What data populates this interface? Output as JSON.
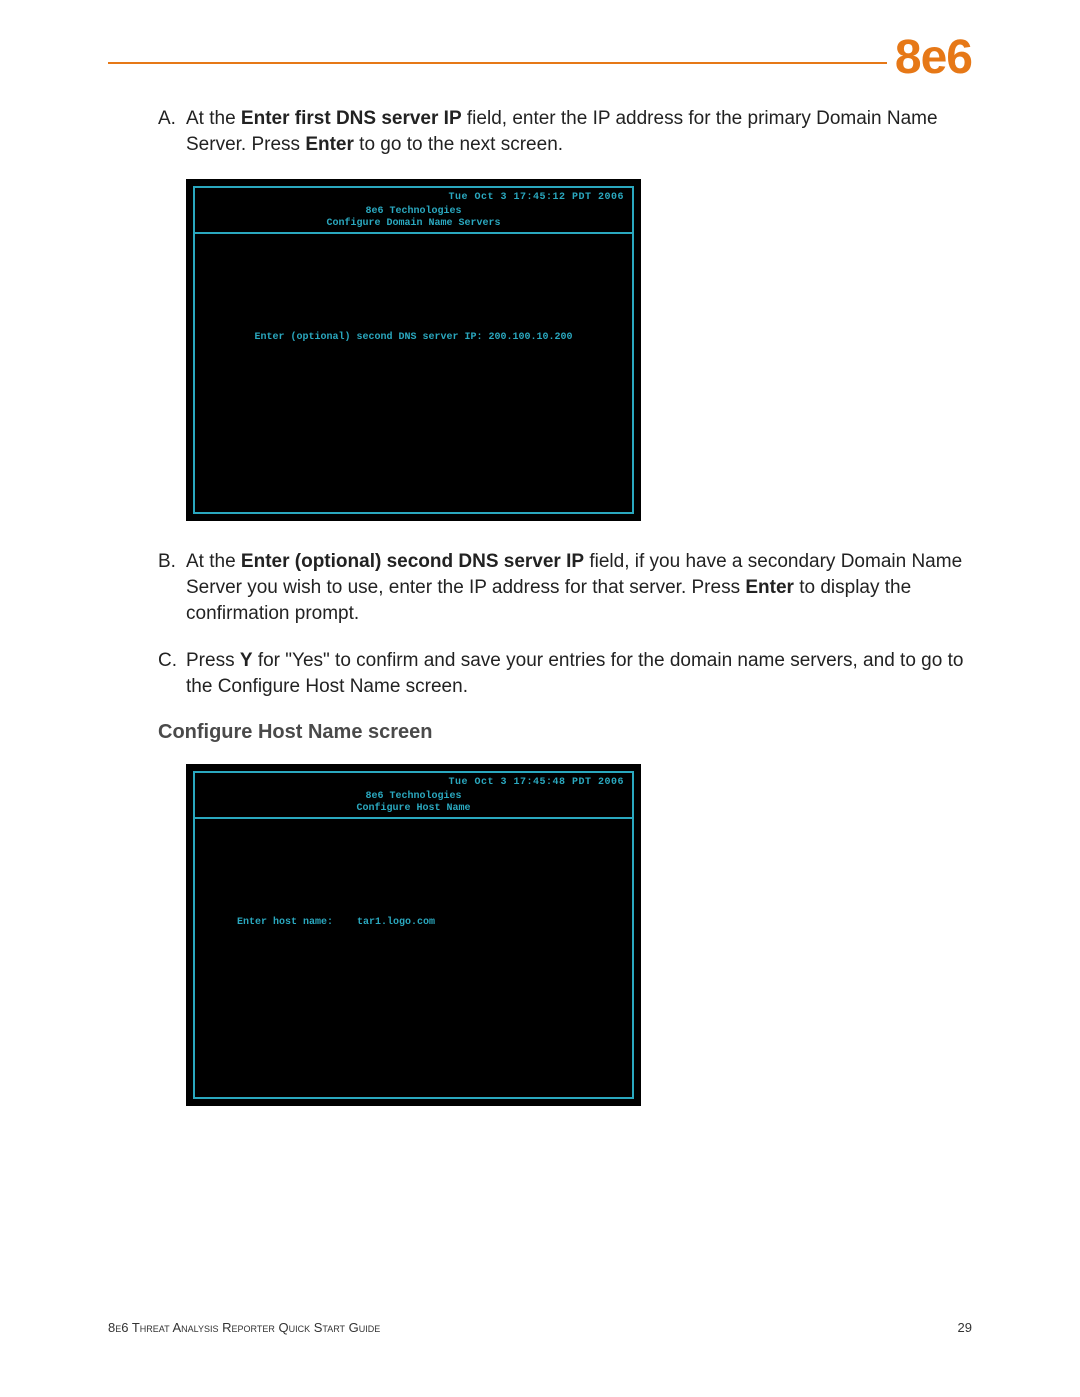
{
  "logo": "8e6",
  "steps": {
    "a": {
      "letter": "A.",
      "pre": "At the ",
      "bold1": "Enter first DNS server IP",
      "mid1": " field, enter the IP address for the primary Domain Name Server. Press ",
      "bold2": "Enter",
      "post": " to go to the next screen."
    },
    "b": {
      "letter": "B.",
      "pre": "At the ",
      "bold1": "Enter (optional) second DNS server IP",
      "mid1": " field, if you have a secondary Domain Name Server you wish to use, enter the IP address for that server. Press ",
      "bold2": "Enter",
      "post": " to display the confirmation prompt."
    },
    "c": {
      "letter": "C.",
      "pre": "Press ",
      "bold1": "Y",
      "mid1": " for \"Yes\" to confirm and save your entries for the domain name servers, and to go to the Configure Host Name screen."
    }
  },
  "terminal1": {
    "time": "Tue Oct  3 17:45:12 PDT 2006",
    "company": "8e6 Technologies",
    "screen": "Configure Domain Name Servers",
    "prompt": "Enter (optional) second DNS server IP: 200.100.10.200"
  },
  "heading": "Configure Host Name screen",
  "terminal2": {
    "time": "Tue Oct  3 17:45:48 PDT 2006",
    "company": "8e6 Technologies",
    "screen": "Configure Host Name",
    "prompt_label": "Enter host name:",
    "prompt_value": "tar1.logo.com"
  },
  "footer": {
    "title": "8e6 Threat Analysis Reporter Quick Start Guide",
    "page": "29"
  }
}
